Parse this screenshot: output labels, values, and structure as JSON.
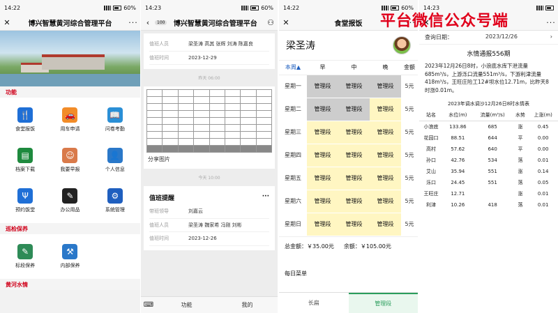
{
  "panel1": {
    "status_time": "14:22",
    "status_battery": "60%",
    "nav_title": "博兴智慧黄河综合管理平台",
    "section_func": "功能",
    "items": [
      {
        "label": "食堂报饭",
        "icon": "fork-icon",
        "color": "#1f6fd6"
      },
      {
        "label": "用车申请",
        "icon": "car-icon",
        "color": "#f28c28"
      },
      {
        "label": "问卷考勤",
        "icon": "book-icon",
        "color": "#2a8fd6"
      },
      {
        "label": "档案下载",
        "icon": "archive-icon",
        "color": "#1e8a3e"
      },
      {
        "label": "我要早报",
        "icon": "person-wave-icon",
        "color": "#d97a4a"
      },
      {
        "label": "个人信息",
        "icon": "user-info-icon",
        "color": "#2a78c9"
      },
      {
        "label": "预约饭堂",
        "icon": "dining-icon",
        "color": "#1f6fd6"
      },
      {
        "label": "办公用品",
        "icon": "pen-icon",
        "color": "#222222"
      },
      {
        "label": "系统管理",
        "icon": "gear-icon",
        "color": "#1f5fbf"
      }
    ],
    "section_patrol": "巡检保养",
    "patrol_items": [
      {
        "label": "标段保养",
        "icon": "edit-icon",
        "color": "#2e8b57"
      },
      {
        "label": "内部保养",
        "icon": "worker-icon",
        "color": "#2a78c9"
      }
    ],
    "section_water": "黄河水情"
  },
  "panel2": {
    "status_time": "14:23",
    "status_battery": "60%",
    "back_badge": "100",
    "nav_title": "博兴智慧黄河综合管理平台",
    "card1": {
      "k1": "值班人员",
      "v1": "梁圣涛 高其 张辉 刘涛 陈嘉良",
      "k2": "值班时间",
      "v2": "2023-12-29"
    },
    "ts1": "昨天 06:00",
    "sheet_rows": [
      [
        "",
        "",
        "",
        "",
        "",
        "",
        "",
        ""
      ],
      [
        "",
        "",
        "",
        "",
        "",
        "",
        "",
        ""
      ],
      [
        "",
        "",
        "",
        "",
        "",
        "",
        "",
        ""
      ],
      [
        "",
        "",
        "",
        "",
        "",
        "",
        "",
        ""
      ],
      [
        "",
        "",
        "",
        "",
        "",
        "",
        "",
        ""
      ],
      [
        "",
        "",
        "",
        "",
        "",
        "",
        "",
        ""
      ],
      [
        "",
        "",
        "",
        "",
        "",
        "",
        "",
        ""
      ],
      [
        "",
        "",
        "",
        "",
        "",
        "",
        "",
        ""
      ],
      [
        "",
        "",
        "",
        "",
        "",
        "",
        "",
        ""
      ]
    ],
    "share_label": "分享图片",
    "ts2": "今天 10:00",
    "card2": {
      "title": "值班提醒",
      "k1": "带班领导",
      "v1": "刘嘉云",
      "k2": "值班人员",
      "v2": "梁圣涛 魏家希 冯刚 刘彬",
      "k3": "值班时间",
      "v3": "2023-12-26"
    },
    "tab1": "功能",
    "tab2": "我的"
  },
  "panel3": {
    "status_time": "14:22",
    "status_battery": "60%",
    "nav_title": "食堂报饭",
    "name": "梁圣涛",
    "headers": [
      "本周▲",
      "早",
      "中",
      "晚",
      "金额"
    ],
    "rows": [
      {
        "day": "星期一",
        "meals": [
          "管理段",
          "管理段",
          "管理段"
        ],
        "styles": [
          "g",
          "g",
          "g"
        ],
        "amount": "5元"
      },
      {
        "day": "星期二",
        "meals": [
          "管理段",
          "管理段",
          "管理段"
        ],
        "styles": [
          "g",
          "g",
          "y"
        ],
        "amount": "5元"
      },
      {
        "day": "星期三",
        "meals": [
          "管理段",
          "管理段",
          "管理段"
        ],
        "styles": [
          "y",
          "y",
          "y"
        ],
        "amount": "5元"
      },
      {
        "day": "星期四",
        "meals": [
          "管理段",
          "管理段",
          "管理段"
        ],
        "styles": [
          "y",
          "y",
          "y"
        ],
        "amount": "5元"
      },
      {
        "day": "星期五",
        "meals": [
          "管理段",
          "管理段",
          "管理段"
        ],
        "styles": [
          "y",
          "y",
          "y"
        ],
        "amount": "5元"
      },
      {
        "day": "星期六",
        "meals": [
          "管理段",
          "管理段",
          "管理段"
        ],
        "styles": [
          "y",
          "y",
          "y"
        ],
        "amount": "5元"
      },
      {
        "day": "星期日",
        "meals": [
          "管理段",
          "管理段",
          "管理段"
        ],
        "styles": [
          "y",
          "y",
          "y"
        ],
        "amount": "5元"
      }
    ],
    "total_label": "总金额：￥35.00元",
    "balance_label": "余额：￥105.00元",
    "menu_title": "每日菜单",
    "menu_tab1": "长扁",
    "menu_tab2": "管理段"
  },
  "overlay_title": "平台微信公众号端",
  "panel4": {
    "status_time": "14:23",
    "nav_title": "",
    "query_label": "查询日期：",
    "query_value": "2023/12/26",
    "report_title": "水情通报556期",
    "report_text": "2023年12月26日8时，小浪底水库下泄流量685m³/s，上游泺口流量551m³/s，下游利津流量418m³/s，王旺庄险工12#坝水位12.71m，比昨天8时涨0.01m。",
    "table_caption": "2023年调水调沙12月26日8时水情表",
    "table_headers": [
      "站名",
      "水位(m)",
      "流量(m³/s)",
      "水势",
      "上涨(m)"
    ],
    "table_rows": [
      [
        "小浪底",
        "133.86",
        "685",
        "涨",
        "0.45"
      ],
      [
        "花园口",
        "88.51",
        "644",
        "平",
        "0.00"
      ],
      [
        "高村",
        "57.62",
        "640",
        "平",
        "0.00"
      ],
      [
        "孙口",
        "42.76",
        "534",
        "落",
        "0.01"
      ],
      [
        "艾山",
        "35.94",
        "551",
        "涨",
        "0.14"
      ],
      [
        "泺口",
        "24.45",
        "551",
        "落",
        "0.05"
      ],
      [
        "王旺庄",
        "12.71",
        "",
        "涨",
        "0.01"
      ],
      [
        "利津",
        "10.26",
        "418",
        "落",
        "0.01"
      ]
    ]
  }
}
